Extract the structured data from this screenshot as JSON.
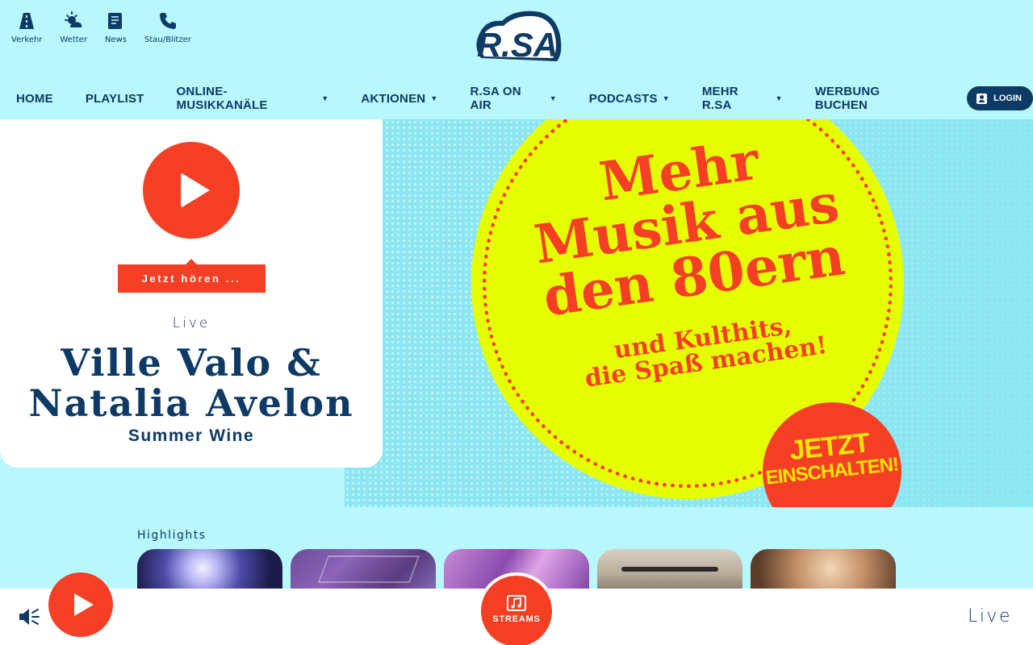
{
  "quick_links": [
    {
      "label": "Verkehr",
      "icon": "road-icon"
    },
    {
      "label": "Wetter",
      "icon": "weather-icon"
    },
    {
      "label": "News",
      "icon": "news-icon"
    },
    {
      "label": "Stau/Blitzer",
      "icon": "phone-icon"
    }
  ],
  "logo": {
    "text": "R.SA"
  },
  "nav": {
    "items": [
      {
        "label": "HOME",
        "caret": ""
      },
      {
        "label": "PLAYLIST",
        "caret": ""
      },
      {
        "label": "ONLINE-MUSIKKANÄLE",
        "caret": "▼"
      },
      {
        "label": "AKTIONEN",
        "caret": "▼"
      },
      {
        "label": "R.SA ON AIR",
        "caret": "▼"
      },
      {
        "label": "PODCASTS",
        "caret": "▼"
      },
      {
        "label": "MEHR R.SA",
        "caret": "▼"
      },
      {
        "label": "WERBUNG BUCHEN",
        "caret": ""
      }
    ],
    "login_label": "LOGIN"
  },
  "player": {
    "listen_label": "Jetzt hören ...",
    "live_label": "Live",
    "artist": "Ville Valo & Natalia Avelon",
    "song": "Summer Wine"
  },
  "banner": {
    "line1": "Mehr",
    "line2": "Musik aus",
    "line3": "den 80ern",
    "sub1": "und Kulthits,",
    "sub2": "die Spaß machen!",
    "cta1": "JETZT",
    "cta2": "EINSCHALTEN!"
  },
  "highlights": {
    "title": "Highlights",
    "cards": [
      "highlight-1",
      "highlight-2",
      "highlight-3",
      "highlight-4",
      "highlight-5"
    ]
  },
  "bottom_bar": {
    "streams_label": "STREAMS",
    "live_label": "Live"
  },
  "colors": {
    "background": "#b8f7fb",
    "accent": "#f43f25",
    "navy": "#0e3a66",
    "banner_yellow": "#e6ff00"
  }
}
